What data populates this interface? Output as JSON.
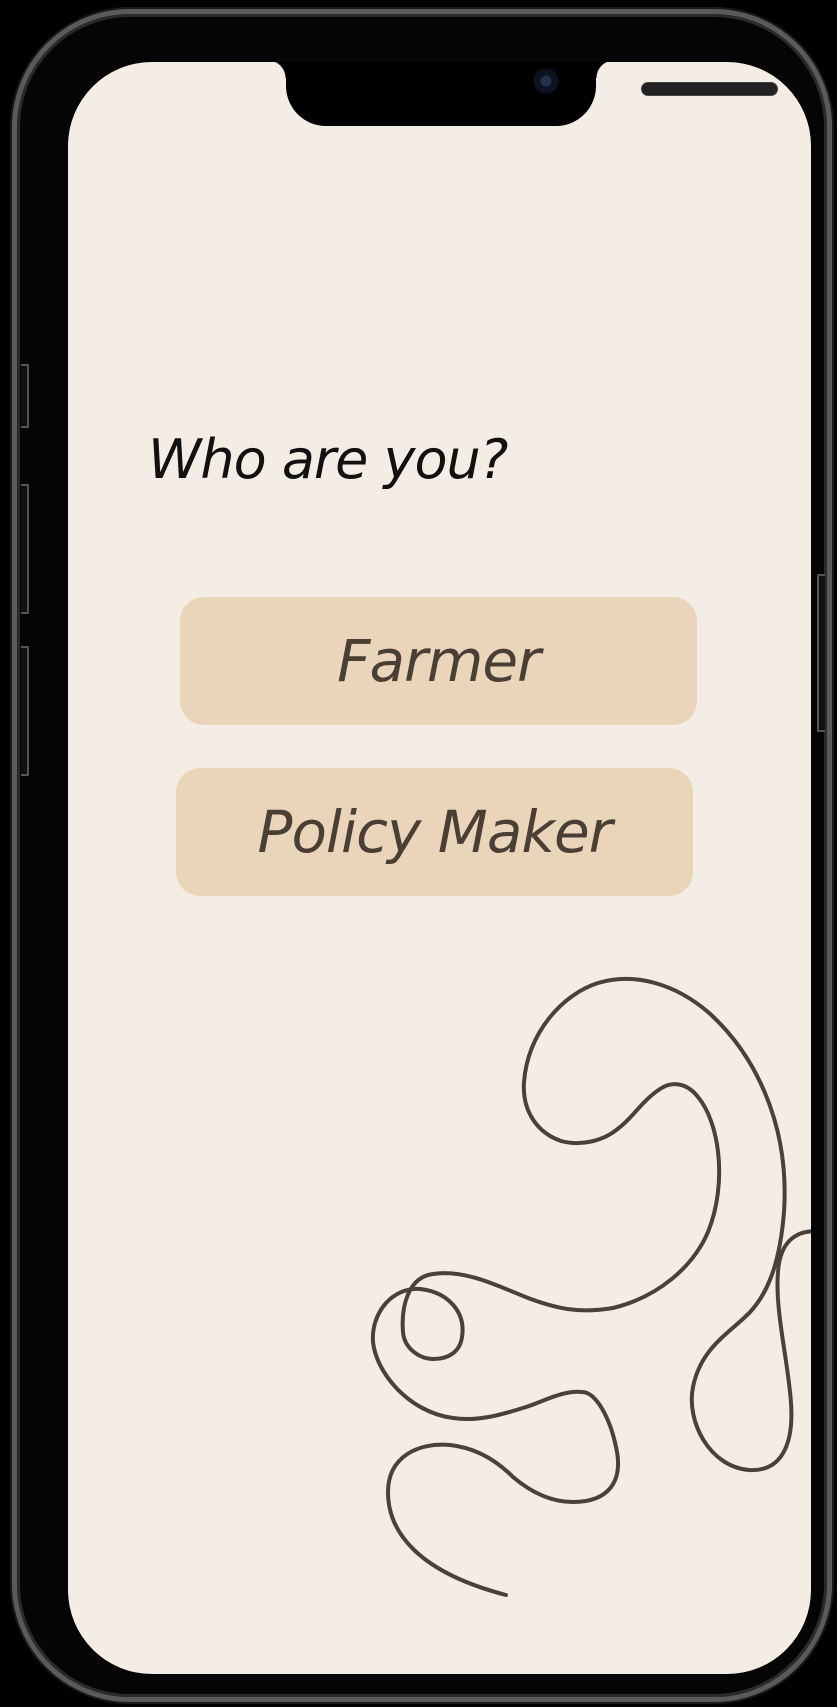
{
  "screen": {
    "title": "Who are you?",
    "options": [
      {
        "label": "Farmer"
      },
      {
        "label": "Policy Maker"
      }
    ]
  },
  "colors": {
    "background": "#f3ede5",
    "button": "#ebd5ba",
    "button_text": "#4a3f35",
    "title_text": "#111111",
    "line": "#4b4137"
  },
  "icons": {
    "decoration": "squiggle-line-icon",
    "camera": "front-camera-icon"
  }
}
